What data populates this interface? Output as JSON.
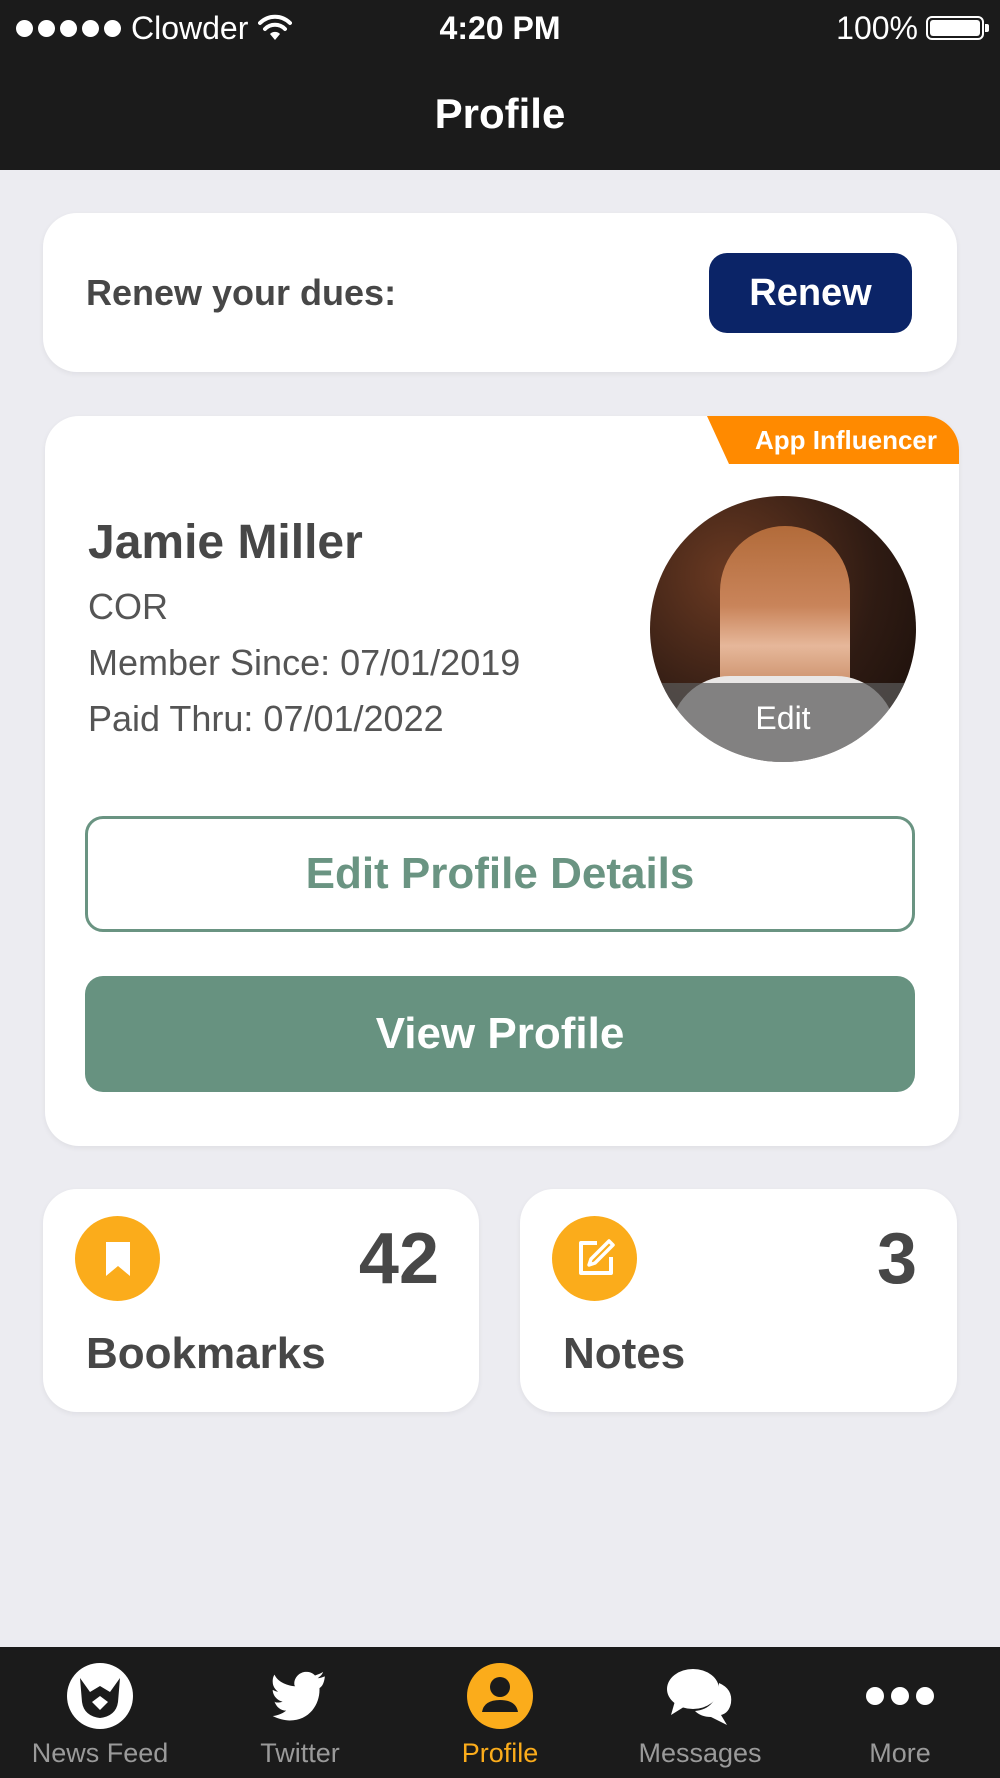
{
  "status_bar": {
    "carrier": "Clowder",
    "time": "4:20 PM",
    "battery": "100%"
  },
  "nav": {
    "title": "Profile"
  },
  "renew": {
    "text": "Renew your dues:",
    "button": "Renew"
  },
  "profile": {
    "badge": "App Influencer",
    "name": "Jamie Miller",
    "role": "COR",
    "member_since": "Member Since: 07/01/2019",
    "paid_thru": "Paid Thru: 07/01/2022",
    "avatar_edit": "Edit",
    "edit_details_button": "Edit Profile Details",
    "view_profile_button": "View Profile"
  },
  "stats": {
    "bookmarks": {
      "count": "42",
      "label": "Bookmarks",
      "icon": "bookmark-icon"
    },
    "notes": {
      "count": "3",
      "label": "Notes",
      "icon": "edit-note-icon"
    }
  },
  "tabs": [
    {
      "label": "News Feed",
      "icon": "cat-logo-icon"
    },
    {
      "label": "Twitter",
      "icon": "twitter-bird-icon"
    },
    {
      "label": "Profile",
      "icon": "person-icon",
      "active": true
    },
    {
      "label": "Messages",
      "icon": "chat-bubbles-icon"
    },
    {
      "label": "More",
      "icon": "ellipsis-icon"
    }
  ],
  "colors": {
    "header": "#1b1b1b",
    "background": "#ececf1",
    "renew_button": "#0b2467",
    "badge": "#ff8a00",
    "green": "#679280",
    "accent": "#fbac1b"
  }
}
